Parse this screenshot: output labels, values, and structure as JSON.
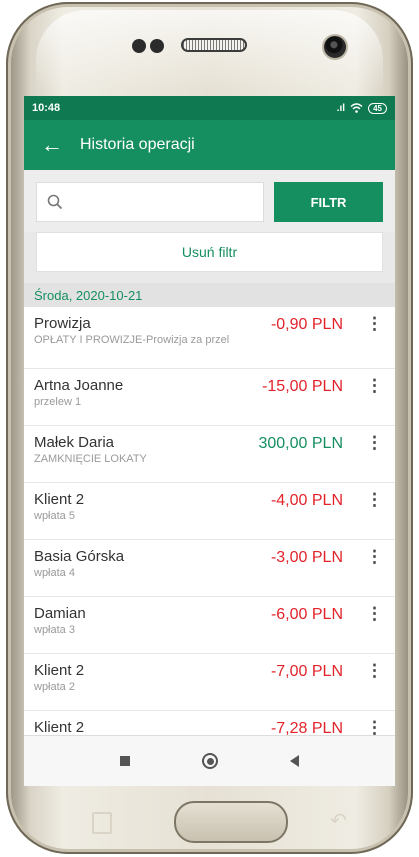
{
  "status_bar": {
    "time": "10:48",
    "signal": ".ıl",
    "wifi_icon": "wifi-icon",
    "battery": "45"
  },
  "app_bar": {
    "back_icon": "arrow-left-icon",
    "title": "Historia operacji"
  },
  "search": {
    "icon": "search-icon",
    "value": "",
    "filter_button": "FILTR"
  },
  "clear_filter_label": "Usuń filtr",
  "date_header": "Środa, 2020-10-21",
  "transactions": [
    {
      "name": "Prowizja",
      "sub": "OPŁATY I PROWIZJE-Prowizja za przel",
      "amount": "-0,90 PLN",
      "type": "neg"
    },
    {
      "name": "Artna Joanne",
      "sub": "przelew 1",
      "amount": "-15,00 PLN",
      "type": "neg"
    },
    {
      "name": "Małek Daria",
      "sub": "ZAMKNIĘCIE LOKATY",
      "amount": "300,00 PLN",
      "type": "pos"
    },
    {
      "name": "Klient 2",
      "sub": "wpłata 5",
      "amount": "-4,00 PLN",
      "type": "neg"
    },
    {
      "name": "Basia Górska",
      "sub": "wpłata 4",
      "amount": "-3,00 PLN",
      "type": "neg"
    },
    {
      "name": "Damian",
      "sub": "wpłata 3",
      "amount": "-6,00 PLN",
      "type": "neg"
    },
    {
      "name": "Klient 2",
      "sub": "wpłata 2",
      "amount": "-7,00 PLN",
      "type": "neg"
    },
    {
      "name": "Klient 2",
      "sub": "",
      "amount": "-7,28 PLN",
      "type": "neg"
    }
  ],
  "more_icon": "more-vertical-icon",
  "colors": {
    "primary_green": "#168f60",
    "status_green": "#0f7a52",
    "negative_red": "#e2232a"
  }
}
